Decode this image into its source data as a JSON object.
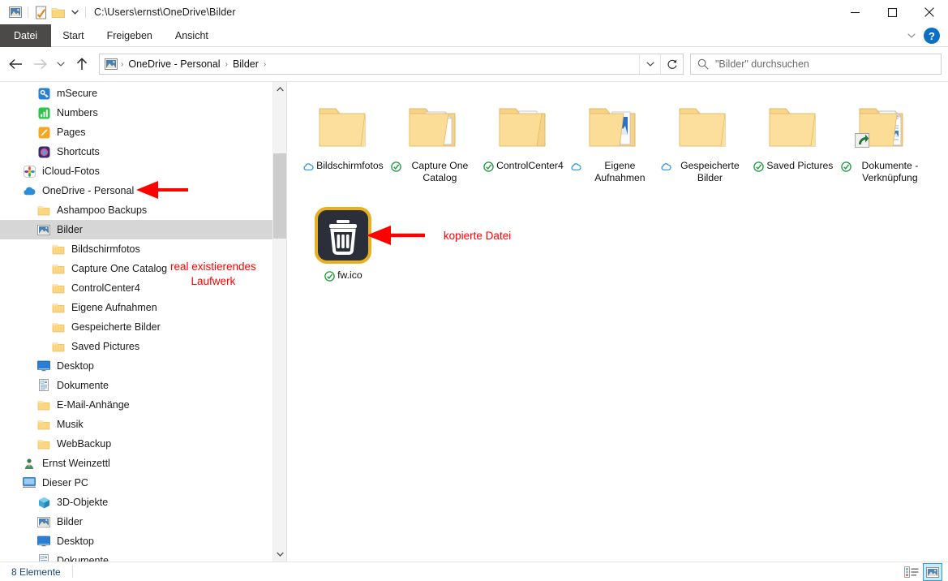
{
  "window": {
    "title_path": "C:\\Users\\ernst\\OneDrive\\Bilder",
    "quick_access_icons": [
      "pictures-icon",
      "checkmark-document-icon",
      "folder-icon"
    ],
    "qat_dropdown": "chevron-down-icon",
    "controls": {
      "minimize": "minimize-icon",
      "maximize": "maximize-icon",
      "close": "close-icon"
    }
  },
  "ribbon": {
    "tabs": [
      {
        "label": "Datei",
        "active_file": true
      },
      {
        "label": "Start",
        "active_file": false
      },
      {
        "label": "Freigeben",
        "active_file": false
      },
      {
        "label": "Ansicht",
        "active_file": false
      }
    ],
    "collapse_icon": "chevron-down-icon",
    "help_label": "?"
  },
  "nav": {
    "back_icon": "arrow-left-icon",
    "forward_icon": "arrow-right-icon",
    "recent_icon": "chevron-down-icon",
    "up_icon": "arrow-up-icon",
    "breadcrumb_icon": "pictures-icon",
    "breadcrumbs": [
      "OneDrive - Personal",
      "Bilder"
    ],
    "separator": "›",
    "address_dropdown_icon": "chevron-down-icon",
    "refresh_icon": "refresh-icon"
  },
  "search": {
    "icon": "search-icon",
    "placeholder": "\"Bilder\" durchsuchen"
  },
  "sidebar": {
    "items": [
      {
        "label": "mSecure",
        "icon": "msecure-key-icon",
        "indent": 44,
        "selected": false
      },
      {
        "label": "Numbers",
        "icon": "numbers-chart-icon",
        "indent": 44,
        "selected": false
      },
      {
        "label": "Pages",
        "icon": "pages-pen-icon",
        "indent": 44,
        "selected": false
      },
      {
        "label": "Shortcuts",
        "icon": "shortcuts-icon",
        "indent": 44,
        "selected": false
      },
      {
        "label": "iCloud-Fotos",
        "icon": "icloud-photos-icon",
        "indent": 26,
        "selected": false
      },
      {
        "label": "OneDrive - Personal",
        "icon": "onedrive-cloud-icon",
        "indent": 26,
        "selected": false
      },
      {
        "label": "Ashampoo Backups",
        "icon": "folder-icon",
        "indent": 44,
        "selected": false
      },
      {
        "label": "Bilder",
        "icon": "pictures-icon",
        "indent": 44,
        "selected": true
      },
      {
        "label": "Bildschirmfotos",
        "icon": "folder-icon",
        "indent": 62,
        "selected": false
      },
      {
        "label": "Capture One Catalog",
        "icon": "folder-icon",
        "indent": 62,
        "selected": false
      },
      {
        "label": "ControlCenter4",
        "icon": "folder-icon",
        "indent": 62,
        "selected": false
      },
      {
        "label": "Eigene Aufnahmen",
        "icon": "folder-icon",
        "indent": 62,
        "selected": false
      },
      {
        "label": "Gespeicherte Bilder",
        "icon": "folder-icon",
        "indent": 62,
        "selected": false
      },
      {
        "label": "Saved Pictures",
        "icon": "folder-icon",
        "indent": 62,
        "selected": false
      },
      {
        "label": "Desktop",
        "icon": "desktop-icon",
        "indent": 44,
        "selected": false
      },
      {
        "label": "Dokumente",
        "icon": "documents-icon",
        "indent": 44,
        "selected": false
      },
      {
        "label": "E-Mail-Anhänge",
        "icon": "folder-icon",
        "indent": 44,
        "selected": false
      },
      {
        "label": "Musik",
        "icon": "folder-icon",
        "indent": 44,
        "selected": false
      },
      {
        "label": "WebBackup",
        "icon": "folder-icon",
        "indent": 44,
        "selected": false
      },
      {
        "label": "Ernst Weinzettl",
        "icon": "user-icon",
        "indent": 26,
        "selected": false
      },
      {
        "label": "Dieser PC",
        "icon": "this-pc-icon",
        "indent": 26,
        "selected": false
      },
      {
        "label": "3D-Objekte",
        "icon": "3d-objects-icon",
        "indent": 44,
        "selected": false
      },
      {
        "label": "Bilder",
        "icon": "pictures-icon",
        "indent": 44,
        "selected": false
      },
      {
        "label": "Desktop",
        "icon": "desktop-icon",
        "indent": 44,
        "selected": false
      },
      {
        "label": "Dokumente",
        "icon": "documents-icon",
        "indent": 44,
        "selected": false
      }
    ],
    "scroll_up_icon": "chevron-up-icon",
    "scroll_down_icon": "chevron-down-icon"
  },
  "content": {
    "items": [
      {
        "label": "Bildschirmfotos",
        "icon": "folder-empty-icon",
        "status": "cloud",
        "selected": false
      },
      {
        "label": "Capture One Catalog",
        "icon": "folder-docs-icon",
        "status": "available",
        "selected": false
      },
      {
        "label": "ControlCenter4",
        "icon": "folder-pages-icon",
        "status": "available",
        "selected": false
      },
      {
        "label": "Eigene Aufnahmen",
        "icon": "folder-photos-icon",
        "status": "cloud",
        "selected": false
      },
      {
        "label": "Gespeicherte Bilder",
        "icon": "folder-empty-icon",
        "status": "cloud",
        "selected": false
      },
      {
        "label": "Saved Pictures",
        "icon": "folder-empty-icon",
        "status": "available",
        "selected": false
      },
      {
        "label": "Dokumente - Verknüpfung",
        "icon": "folder-shortcut-icon",
        "status": "available",
        "selected": false
      },
      {
        "label": "fw.ico",
        "icon": "trash-app-icon",
        "status": "available",
        "selected": true
      }
    ]
  },
  "statusbar": {
    "count_text": "8 Elemente",
    "views": [
      {
        "name": "details-view-button",
        "active": false
      },
      {
        "name": "large-icons-view-button",
        "active": true
      }
    ]
  },
  "annotations": [
    {
      "text": "real existierendes\nLaufwerk",
      "color": "#ff0000"
    },
    {
      "text": "kopierte Datei",
      "color": "#ff0000"
    }
  ],
  "colors": {
    "accent": "#0b6fc4",
    "annotation": "#ff0000",
    "selection": "#d6d6d6",
    "folder": "#fbd888",
    "status_text": "#16487a"
  }
}
